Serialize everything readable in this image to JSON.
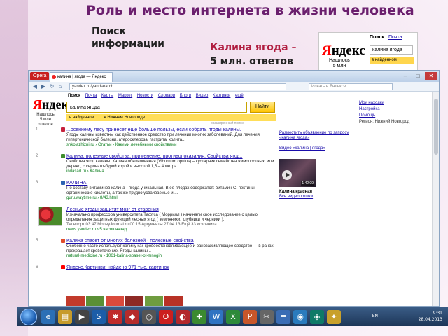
{
  "slide": {
    "title": "Роль и место интернета в жизни человека",
    "subtitle": "Поиск информации",
    "note_part1": "Калина ягода –",
    "note_part2": "5 млн. ответов"
  },
  "snippet": {
    "links": [
      "Поиск",
      "Почта",
      "|"
    ],
    "logo_y": "Я",
    "logo_rest": "ндекс",
    "found_line1": "Нашлось",
    "found_line2": "5 млн",
    "query": "калина ягода",
    "option": "в найденном"
  },
  "browser": {
    "opera_label": "Opera",
    "tab_title": "калина | ягода — Яндекс",
    "address": "yandex.ru/yandsearch",
    "search_placeholder": "Искать в Яндексе",
    "services": [
      "Поиск",
      "Почта",
      "Карты",
      "Маркет",
      "Новости",
      "Словари",
      "Блоги",
      "Видео",
      "Картинки",
      "ещё"
    ],
    "logo_y": "Я",
    "logo_rest": "ндекс",
    "found_line1": "Нашлось",
    "found_line2": "5 млн ответов",
    "query": "калина  ягода",
    "find_button": "Найти",
    "options": [
      "в найденном",
      "в Нижнем Новгороде"
    ],
    "advanced": "расширенный поиск",
    "side_links": [
      "Мои находки",
      "Настройка",
      "Помощь",
      "Регион: Нижний Новгород"
    ],
    "results": [
      {
        "num": "1",
        "title": "...осеннему лесу принесет еще больше пользы, если собрать ягоды калины.",
        "text": "Ягоды калины известны как действенное средство при лечении многих заболеваний. Для лечения гипертонической болезни, атеросклероза, гастрита, колита...",
        "url": "shkolazhizni.ru › Статьи › Какими лечебными свойствами"
      },
      {
        "num": "2",
        "title": "Калина, полезные свойства, применение, противопоказания. Свойства ягод..",
        "text": "Свойства ягод калины. Калина обыкновенная (Viburnum opulus) – кустарник семейства жимолостных, или дерево, с серовато-бурой корой и высотой 1,5 – 4 метра.",
        "url": "indasad.ru › Калина"
      },
      {
        "num": "3",
        "title": "КАЛИНА.",
        "text": "По составу витаминов калина - ягода уникальная. В ее плодах содержатся: витамин С, пектины, органические кислоты, а так же трудно усваиваемые и ...",
        "url": "guru.waytime.ru › 8/43.html"
      },
      {
        "num": "4",
        "title": "Лесные ягоды защитят мозг от старения",
        "text": "Изначально профессора университета Тафтса ( Моррилл ) начинали свое исследование с целью определения защитных функций лесных ягод ( земляники, клубники и черники ).",
        "url": "news.yandex.ru › 5 часов назад"
      },
      {
        "num": "5",
        "title": "Калина спасет от многих болезней · полезные свойства",
        "text": "Особенно часто используют калину как кровоостанавливающее и ранозаживляющее средство — в ранах прекращает кровотечение. Ягоды калины...",
        "url": "natural-medicine.ru › 1061-kalina-spaset-ot-mnogih"
      },
      {
        "num": "6",
        "title": "Яндекс.Картинки: найдено 971 тыс. картинок",
        "text": "",
        "url": ""
      }
    ],
    "news_sources": "Телепорт 03:47   MoneyJournal.ru 00:15   Аргументы 27.04.13   Ещё 33 источника",
    "right_ad": "Разместить объявление по запросу «калина ягода»",
    "right_video_label": "Видео «калина | ягода»",
    "video_duration": "1:42:09",
    "right_caption": "Калина красная",
    "right_more": "Все видеоролики"
  },
  "taskbar": {
    "lang": "EN",
    "time": "9:31",
    "date": "28.04.2013"
  },
  "colors": {
    "title": "#6b1f6e",
    "accent": "#b01c3f",
    "yandex_red": "#ff0000",
    "yandex_yellow": "#ffde59"
  }
}
